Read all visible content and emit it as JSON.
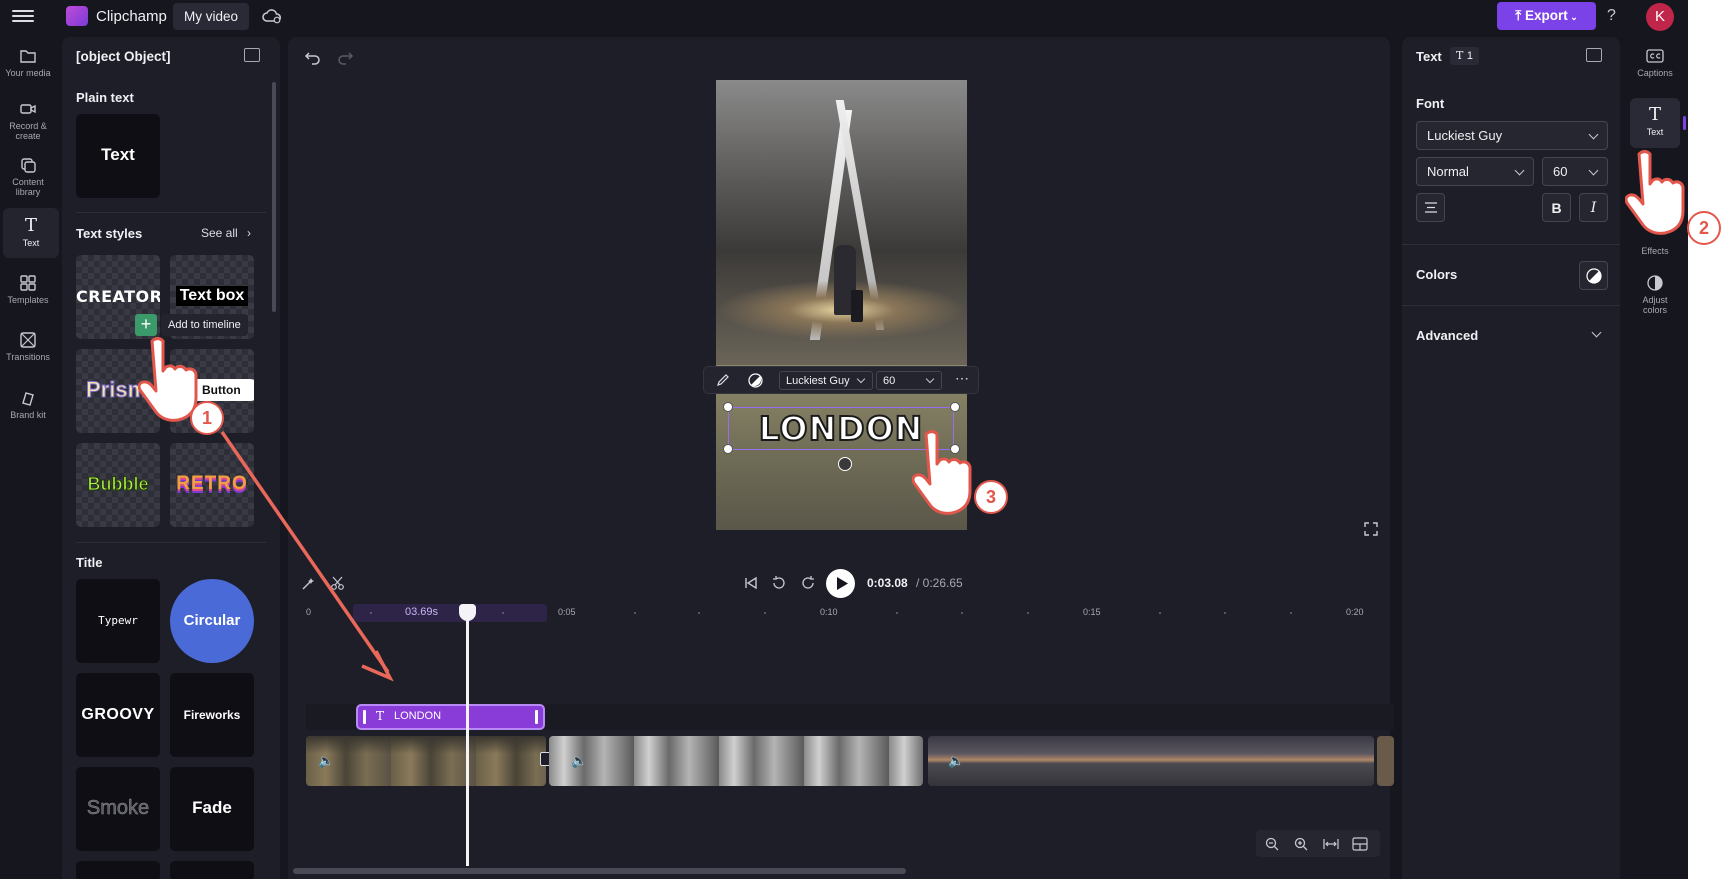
{
  "app": {
    "name": "Clipchamp",
    "project_name": "My video",
    "export_label": "Export",
    "help_label": "?",
    "avatar_initial": "K",
    "accent_color": "#7b42e8"
  },
  "left_rail": [
    {
      "label": "Your media",
      "icon": "folder-icon"
    },
    {
      "label": "Record & create",
      "icon": "camera-icon"
    },
    {
      "label": "Content library",
      "icon": "library-icon"
    },
    {
      "label": "Text",
      "icon": "text-icon",
      "active": true
    },
    {
      "label": "Templates",
      "icon": "templates-icon"
    },
    {
      "label": "Transitions",
      "icon": "transitions-icon"
    },
    {
      "label": "Brand kit",
      "icon": "brand-kit-icon"
    }
  ],
  "left_panel": {
    "title": {
      "heading": "Title",
      "tiles": [
        "Typewr",
        "Circular",
        "GROOVY",
        "Fireworks",
        "Smoke",
        "Fade"
      ]
    },
    "plain_text": {
      "heading": "Plain text",
      "tile": "Text"
    },
    "text_styles": {
      "heading": "Text styles",
      "see_all": "See all",
      "tiles": [
        "CREATOR",
        "Text box",
        "Prism",
        "Button",
        "Bubble",
        "RETRO"
      ],
      "add_tooltip": "Add to timeline"
    }
  },
  "editor": {
    "floating_toolbar": {
      "font": "Luckiest Guy",
      "size": "60"
    },
    "overlay_text": "LONDON",
    "playback": {
      "current": "0:03.08",
      "total": "/ 0:26.65"
    },
    "timeline": {
      "ruler_labels": [
        "0",
        "0:05",
        "0:10",
        "0:15",
        "0:20"
      ],
      "time_chip": "03.69s",
      "text_clip_label": "LONDON"
    }
  },
  "properties": {
    "title": "Text",
    "layer_count": "1",
    "font_section": "Font",
    "font": "Luckiest Guy",
    "weight": "Normal",
    "size": "60",
    "bold_label": "B",
    "italic_label": "I",
    "colors_section": "Colors",
    "advanced_section": "Advanced"
  },
  "right_rail": [
    {
      "label": "Captions",
      "icon": "captions-icon"
    },
    {
      "label": "Text",
      "icon": "text-icon",
      "active": true
    },
    {
      "label": "Effects",
      "icon": "effects-icon"
    },
    {
      "label": "Adjust colors",
      "icon": "adjust-colors-icon"
    }
  ],
  "tutorial_steps": [
    "1",
    "2",
    "3"
  ]
}
